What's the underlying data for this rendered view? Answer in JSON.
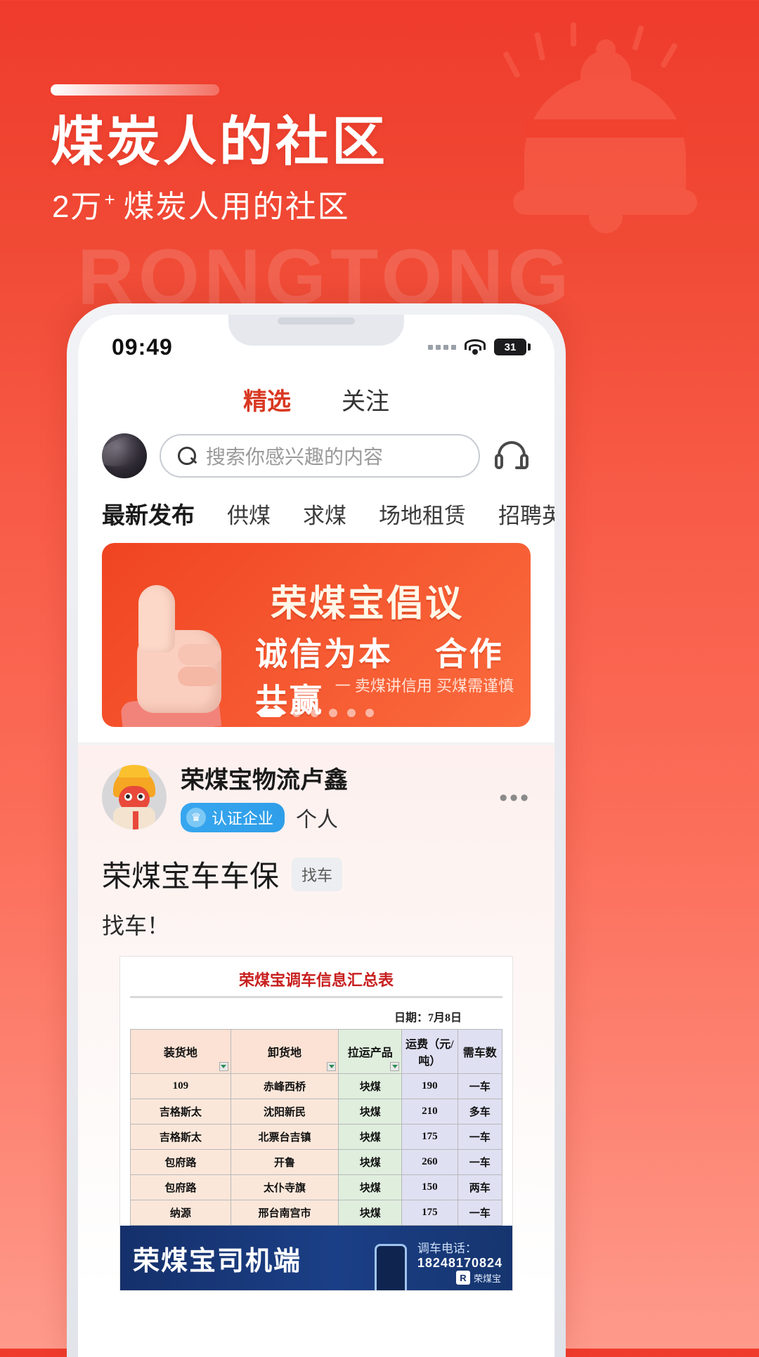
{
  "hero": {
    "headline": "煤炭人的社区",
    "sub_number": "2万",
    "sub_sup": "+",
    "sub_rest": "煤炭人用的社区",
    "watermark": "RONGTONG",
    "bg_accent": "#f04a35"
  },
  "phone": {
    "status": {
      "time": "09:49",
      "battery_level": "31",
      "signal_icon": "signal-dots-icon",
      "wifi_icon": "wifi-icon",
      "battery_icon": "battery-icon"
    },
    "tabs": [
      {
        "label": "精选",
        "active": true
      },
      {
        "label": "关注",
        "active": false
      }
    ],
    "search": {
      "placeholder": "搜索你感兴趣的内容",
      "icon": "search-icon",
      "avatar": "user-avatar",
      "service_icon": "headset-icon"
    },
    "categories": [
      {
        "label": "最新发布",
        "active": true
      },
      {
        "label": "供煤",
        "active": false
      },
      {
        "label": "求煤",
        "active": false
      },
      {
        "label": "场地租赁",
        "active": false
      },
      {
        "label": "招聘英才",
        "active": false
      }
    ],
    "banner": {
      "title": "荣煤宝倡议",
      "subtitle_left": "诚信为本",
      "subtitle_right": "合作共赢",
      "note": "一 卖煤讲信用 买煤需谨慎",
      "dots_total": 6,
      "dots_active_index": 0,
      "bg_color": "#f5562f"
    },
    "post": {
      "author": "荣煤宝物流卢鑫",
      "badge": "认证企业",
      "badge_icon": "crown-icon",
      "account_type": "个人",
      "more_icon": "more-dots-icon",
      "title": "荣煤宝车车保",
      "tag": "找车",
      "body": "找车！",
      "attachment": {
        "title": "荣煤宝调车信息汇总表",
        "date": "日期：7月8日",
        "columns": [
          "装货地",
          "卸货地",
          "拉运产品",
          "运费（元/吨）",
          "需车数"
        ],
        "rows": [
          [
            "109",
            "赤峰西桥",
            "块煤",
            "190",
            "一车"
          ],
          [
            "吉格斯太",
            "沈阳新民",
            "块煤",
            "210",
            "多车"
          ],
          [
            "吉格斯太",
            "北票台吉镇",
            "块煤",
            "175",
            "一车"
          ],
          [
            "包府路",
            "开鲁",
            "块煤",
            "260",
            "一车"
          ],
          [
            "包府路",
            "太仆寺旗",
            "块煤",
            "150",
            "两车"
          ],
          [
            "纳源",
            "邢台南宫市",
            "块煤",
            "175",
            "一车"
          ]
        ],
        "footer_banner": {
          "title": "荣煤宝司机端",
          "contact_label": "调车电话：",
          "contact_number": "18248170824",
          "logo_mark": "R",
          "logo_text": "荣煤宝"
        }
      }
    }
  }
}
